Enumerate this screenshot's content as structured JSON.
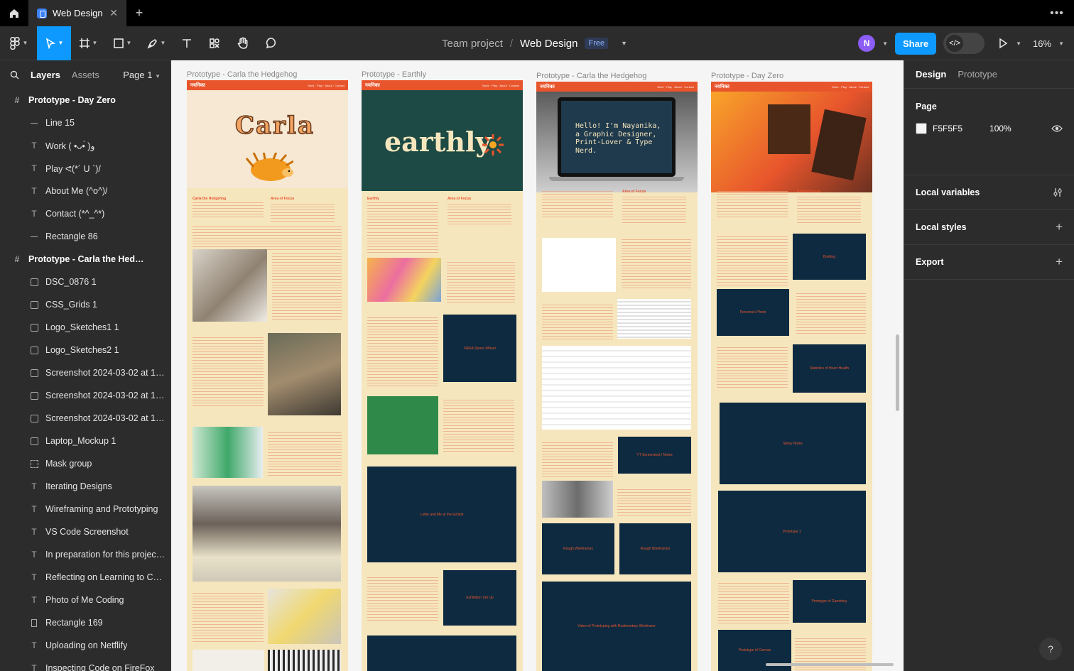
{
  "tabs": {
    "active_tab": "Web Design"
  },
  "toolbar": {
    "team": "Team project",
    "separator": "/",
    "file_name": "Web Design",
    "plan_badge": "Free",
    "share_label": "Share",
    "avatar_initial": "N",
    "zoom": "16%"
  },
  "left_panel": {
    "tab_layers": "Layers",
    "tab_assets": "Assets",
    "page_selector": "Page 1",
    "layers": [
      {
        "label": "Prototype - Day Zero",
        "icon": "frame-icon",
        "type": "frame"
      },
      {
        "label": "Line 15",
        "icon": "line-icon",
        "type": "line"
      },
      {
        "label": "Work ( •ᴗ•́ )و",
        "icon": "text-icon",
        "type": "text"
      },
      {
        "label": "Play ᕙ(*´ U `)/",
        "icon": "text-icon",
        "type": "text"
      },
      {
        "label": "About Me (^o^)/",
        "icon": "text-icon",
        "type": "text"
      },
      {
        "label": "Contact (*^_^*)",
        "icon": "text-icon",
        "type": "text"
      },
      {
        "label": "Rectangle 86",
        "icon": "line-icon",
        "type": "line"
      },
      {
        "label": "Prototype - Carla the Hedgehog",
        "icon": "frame-icon",
        "type": "frame"
      },
      {
        "label": "DSC_0876 1",
        "icon": "image-icon",
        "type": "image"
      },
      {
        "label": "CSS_Grids 1",
        "icon": "image-icon",
        "type": "image"
      },
      {
        "label": "Logo_Sketches1 1",
        "icon": "image-icon",
        "type": "image"
      },
      {
        "label": "Logo_Sketches2 1",
        "icon": "image-icon",
        "type": "image"
      },
      {
        "label": "Screenshot 2024-03-02 at 18....",
        "icon": "image-icon",
        "type": "image"
      },
      {
        "label": "Screenshot 2024-03-02 at 17....",
        "icon": "image-icon",
        "type": "image"
      },
      {
        "label": "Screenshot 2024-03-02 at 17....",
        "icon": "image-icon",
        "type": "image"
      },
      {
        "label": "Laptop_Mockup 1",
        "icon": "image-icon",
        "type": "image"
      },
      {
        "label": "Mask group",
        "icon": "mask-icon",
        "type": "mask"
      },
      {
        "label": "Iterating Designs",
        "icon": "text-icon",
        "type": "text"
      },
      {
        "label": "Wireframing and Prototyping",
        "icon": "text-icon",
        "type": "text"
      },
      {
        "label": "VS Code Screenshot",
        "icon": "text-icon",
        "type": "text"
      },
      {
        "label": "In preparation for this project,...",
        "icon": "text-icon",
        "type": "text"
      },
      {
        "label": "Reflecting on Learning to Cod...",
        "icon": "text-icon",
        "type": "text"
      },
      {
        "label": "Photo of Me Coding",
        "icon": "text-icon",
        "type": "text"
      },
      {
        "label": "Rectangle 169",
        "icon": "rectangle-icon",
        "type": "rect"
      },
      {
        "label": "Uploading on Netflify",
        "icon": "text-icon",
        "type": "text"
      },
      {
        "label": "Inspecting Code on FireFox",
        "icon": "text-icon",
        "type": "text"
      }
    ]
  },
  "canvas": {
    "background": "#F5F5F5",
    "frames": [
      {
        "label": "Prototype - Carla the Hedgehog",
        "hero_text": "Carla"
      },
      {
        "label": "Prototype - Earthly",
        "hero_text": "earthly"
      },
      {
        "label": "Prototype - Carla the Hedgehog",
        "hero_text": "Hello! I'm Nayanika, a Graphic Designer, Print-Lover & Type Nerd."
      },
      {
        "label": "Prototype - Day Zero",
        "hero_text": ""
      }
    ],
    "placeholders": {
      "nasa": "NASA Space Wheel",
      "lettie": "Lettie and Me at the Exhibit",
      "exhibition": "Exhibition Set Up",
      "yt": "YT Screenshot / Notes",
      "rough1": "Rough Wireframes",
      "rough2": "Rough Wireframes",
      "video": "Video of Prototyping with Rudimentary Wireframe",
      "briefing": "Briefing",
      "persona": "Persona's Photo",
      "stats": "Statistics of Heart Health",
      "sticky": "Sticky Notes",
      "proto1": "Prototype 1",
      "gameboy": "Prototype of Gameboy",
      "canvas": "Prototype of Canvas"
    }
  },
  "right_panel": {
    "tab_design": "Design",
    "tab_prototype": "Prototype",
    "page_title": "Page",
    "page_fill_hex": "F5F5F5",
    "page_fill_opacity": "100%",
    "local_variables": "Local variables",
    "local_styles": "Local styles",
    "export": "Export"
  },
  "colors": {
    "accent": "#0d99ff",
    "brand_orange": "#e8552c",
    "frame_cream": "#f6e6be",
    "navy": "#0d2a40"
  }
}
